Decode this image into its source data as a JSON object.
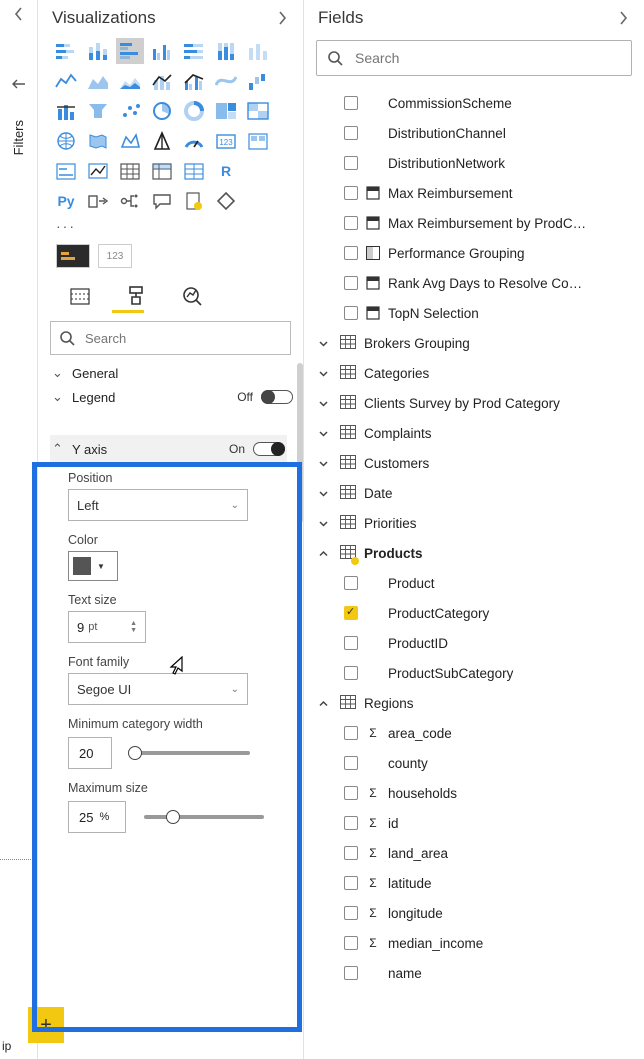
{
  "rail": {
    "filters_label": "Filters",
    "ip_suffix": "ip"
  },
  "viz": {
    "title": "Visualizations",
    "r_label": "R",
    "py_label": "Py",
    "well_value": "123",
    "search_placeholder": "Search",
    "sections": {
      "general": {
        "label": "General"
      },
      "legend": {
        "label": "Legend",
        "state": "Off"
      },
      "yaxis": {
        "label": "Y axis",
        "state": "On"
      }
    },
    "yaxis_props": {
      "position_label": "Position",
      "position_value": "Left",
      "color_label": "Color",
      "color_value": "#555555",
      "textsize_label": "Text size",
      "textsize_value": "9",
      "textsize_unit": "pt",
      "font_label": "Font family",
      "font_value": "Segoe UI",
      "mincat_label": "Minimum category width",
      "mincat_value": "20",
      "maxsize_label": "Maximum size",
      "maxsize_value": "25",
      "maxsize_unit": "%"
    }
  },
  "fields": {
    "title": "Fields",
    "search_placeholder": "Search",
    "loose_fields": [
      {
        "label": "CommissionScheme",
        "calc": false
      },
      {
        "label": "DistributionChannel",
        "calc": false
      },
      {
        "label": "DistributionNetwork",
        "calc": false
      },
      {
        "label": "Max Reimbursement",
        "calc": true
      },
      {
        "label": "Max Reimbursement by ProdC…",
        "calc": true
      },
      {
        "label": "Performance Grouping",
        "calc": true,
        "calc_variant": "group"
      },
      {
        "label": "Rank Avg Days to Resolve Co…",
        "calc": true
      },
      {
        "label": "TopN Selection",
        "calc": true
      }
    ],
    "tables": [
      {
        "label": "Brokers Grouping",
        "expanded": false
      },
      {
        "label": "Categories",
        "expanded": false
      },
      {
        "label": "Clients Survey by Prod Category",
        "expanded": false
      },
      {
        "label": "Complaints",
        "expanded": false
      },
      {
        "label": "Customers",
        "expanded": false
      },
      {
        "label": "Date",
        "expanded": false
      },
      {
        "label": "Priorities",
        "expanded": false
      },
      {
        "label": "Products",
        "expanded": true,
        "active": true,
        "children": [
          {
            "label": "Product",
            "checked": false
          },
          {
            "label": "ProductCategory",
            "checked": true
          },
          {
            "label": "ProductID",
            "checked": false
          },
          {
            "label": "ProductSubCategory",
            "checked": false
          }
        ]
      },
      {
        "label": "Regions",
        "expanded": true,
        "children": [
          {
            "label": "area_code",
            "sigma": true
          },
          {
            "label": "county"
          },
          {
            "label": "households",
            "sigma": true
          },
          {
            "label": "id",
            "sigma": true
          },
          {
            "label": "land_area",
            "sigma": true
          },
          {
            "label": "latitude",
            "sigma": true
          },
          {
            "label": "longitude",
            "sigma": true
          },
          {
            "label": "median_income",
            "sigma": true
          },
          {
            "label": "name"
          }
        ]
      }
    ]
  }
}
